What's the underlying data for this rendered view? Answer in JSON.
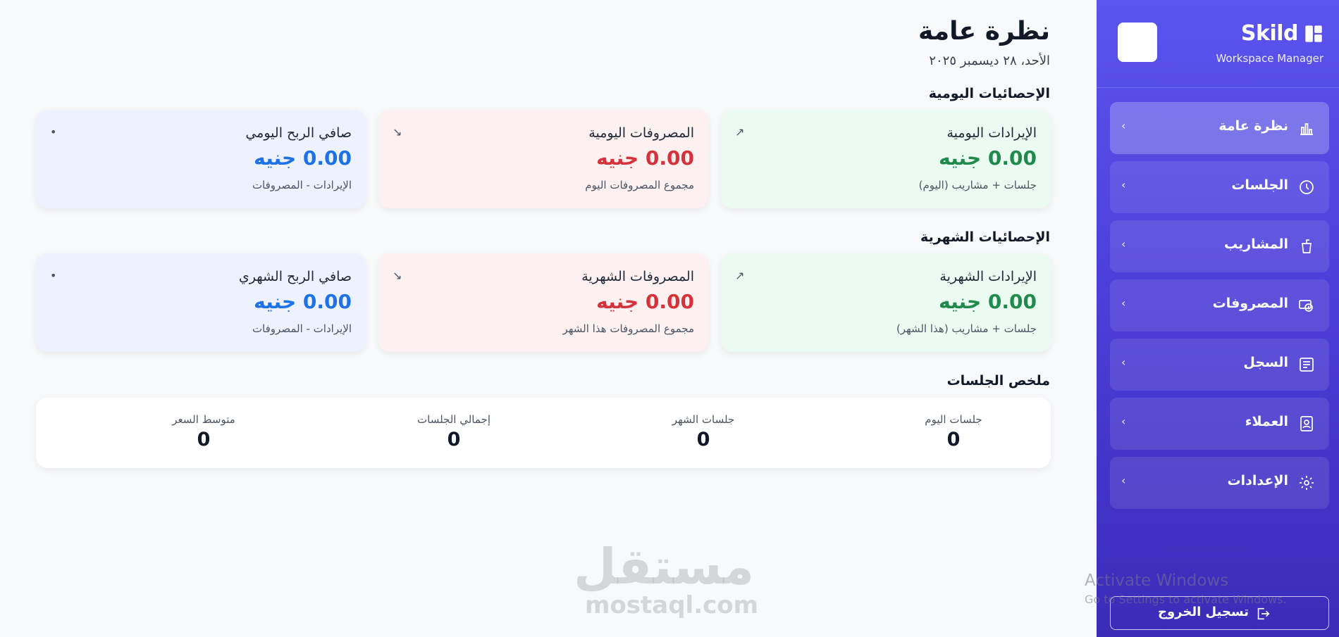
{
  "brand": {
    "name": "Skild",
    "subtitle": "Workspace Manager"
  },
  "nav": [
    {
      "label": "نظرة عامة",
      "icon": "bar-chart-icon",
      "active": true
    },
    {
      "label": "الجلسات",
      "icon": "clock-icon"
    },
    {
      "label": "المشاريب",
      "icon": "cup-icon"
    },
    {
      "label": "المصروفات",
      "icon": "money-icon"
    },
    {
      "label": "السجل",
      "icon": "receipt-icon"
    },
    {
      "label": "العملاء",
      "icon": "contact-card-icon"
    },
    {
      "label": "الإعدادات",
      "icon": "gear-icon"
    }
  ],
  "logout_label": "تسجيل الخروج",
  "page": {
    "title": "نظرة عامة",
    "date": "الأحد، ٢٨ ديسمبر ٢٠٢٥"
  },
  "sections": {
    "daily": "الإحصائيات اليومية",
    "monthly": "الإحصائيات الشهرية",
    "summary": "ملخص الجلسات"
  },
  "daily": [
    {
      "title": "الإيرادات اليومية",
      "value": "0.00 جنيه",
      "sub": "جلسات + مشاريب (اليوم)",
      "indicator": "↗"
    },
    {
      "title": "المصروفات اليومية",
      "value": "0.00 جنيه",
      "sub": "مجموع المصروفات اليوم",
      "indicator": "↘"
    },
    {
      "title": "صافي الربح اليومي",
      "value": "0.00 جنيه",
      "sub": "الإيرادات - المصروفات",
      "indicator": "•"
    }
  ],
  "monthly": [
    {
      "title": "الإيرادات الشهرية",
      "value": "0.00 جنيه",
      "sub": "جلسات + مشاريب (هذا الشهر)",
      "indicator": "↗"
    },
    {
      "title": "المصروفات الشهرية",
      "value": "0.00 جنيه",
      "sub": "مجموع المصروفات هذا الشهر",
      "indicator": "↘"
    },
    {
      "title": "صافي الربح الشهري",
      "value": "0.00 جنيه",
      "sub": "الإيرادات - المصروفات",
      "indicator": "•"
    }
  ],
  "summary": [
    {
      "label": "جلسات اليوم",
      "value": "0"
    },
    {
      "label": "جلسات الشهر",
      "value": "0"
    },
    {
      "label": "إجمالي الجلسات",
      "value": "0"
    },
    {
      "label": "متوسط السعر",
      "value": "0"
    }
  ],
  "watermark": {
    "ar": "مستقل",
    "en": "mostaql.com"
  },
  "windows": {
    "line1": "Activate Windows",
    "line2": "Go to Settings to activate Windows."
  },
  "colors": {
    "accent": "#5b54ee",
    "revenue": "#1f8a4c",
    "expense": "#d6323c",
    "profit": "#1d72e8"
  }
}
